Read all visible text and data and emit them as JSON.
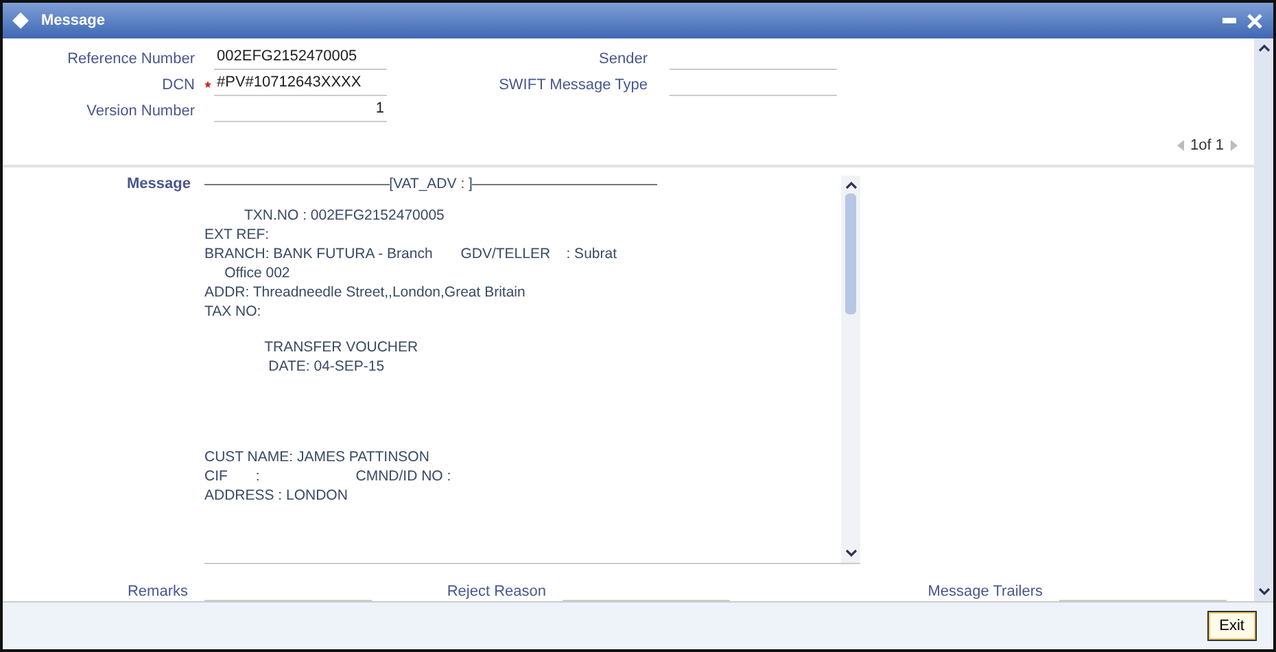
{
  "window": {
    "title": "Message"
  },
  "fields_left": [
    {
      "label": "Reference Number",
      "value": "002EFG2152470005",
      "required": false,
      "kind": "text"
    },
    {
      "label": "DCN",
      "value": "#PV#10712643XXXX",
      "required": true,
      "kind": "text"
    },
    {
      "label": "Version Number",
      "value": "1",
      "required": false,
      "kind": "number"
    }
  ],
  "fields_right": [
    {
      "label": "Sender"
    },
    {
      "label": "SWIFT Message Type"
    }
  ],
  "pager": {
    "text": "1of 1"
  },
  "message": {
    "label": "Message",
    "header": "[VAT_ADV : ]",
    "blocks": [
      [
        "          TXN.NO : 002EFG2152470005",
        "EXT REF:",
        "BRANCH: BANK FUTURA - Branch       GDV/TELLER    : Subrat",
        "     Office 002",
        "ADDR: Threadneedle Street,,London,Great Britain",
        "TAX NO:"
      ],
      [
        "               TRANSFER VOUCHER",
        "                DATE: 04-SEP-15"
      ],
      [
        "CUST NAME: JAMES PATTINSON",
        "CIF       :                        CMND/ID NO :",
        "ADDRESS : LONDON"
      ]
    ]
  },
  "bottom_fields": [
    {
      "label": "Remarks"
    },
    {
      "label": "Reject Reason"
    },
    {
      "label": "Message Trailers"
    }
  ],
  "footer": {
    "button": "Exit"
  }
}
